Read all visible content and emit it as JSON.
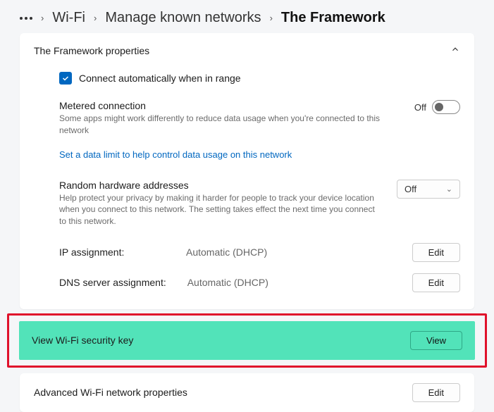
{
  "breadcrumb": {
    "items": [
      "Wi-Fi",
      "Manage known networks"
    ],
    "current": "The Framework"
  },
  "card": {
    "title": "The Framework properties",
    "connect_auto_label": "Connect automatically when in range",
    "metered": {
      "title": "Metered connection",
      "subtitle": "Some apps might work differently to reduce data usage when you're connected to this network",
      "state_label": "Off"
    },
    "data_limit_link": "Set a data limit to help control data usage on this network",
    "random_hw": {
      "title": "Random hardware addresses",
      "subtitle": "Help protect your privacy by making it harder for people to track your device location when you connect to this network. The setting takes effect the next time you connect to this network.",
      "value": "Off"
    },
    "ip_assignment": {
      "key": "IP assignment:",
      "value": "Automatic (DHCP)",
      "button": "Edit"
    },
    "dns_assignment": {
      "key": "DNS server assignment:",
      "value": "Automatic (DHCP)",
      "button": "Edit"
    }
  },
  "security_key": {
    "label": "View Wi-Fi security key",
    "button": "View"
  },
  "advanced": {
    "label": "Advanced Wi-Fi network properties",
    "button": "Edit"
  }
}
